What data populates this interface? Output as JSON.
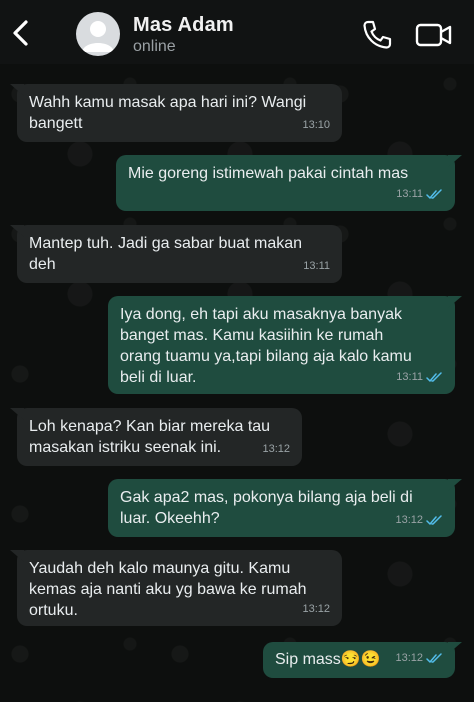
{
  "contact": {
    "name": "Mas Adam",
    "status": "online"
  },
  "colors": {
    "incoming": "#232626",
    "outgoing": "#1f4c3f",
    "tick": "#53bdeb"
  },
  "messages": [
    {
      "dir": "in",
      "text": "Wahh kamu masak apa hari ini? Wangi\nbangett",
      "time": "13:10"
    },
    {
      "dir": "out",
      "text": "Mie goreng istimewah pakai cintah mas",
      "time": "13:11"
    },
    {
      "dir": "in",
      "text": "Mantep tuh. Jadi ga sabar buat makan\ndeh",
      "time": "13:11"
    },
    {
      "dir": "out",
      "text": "Iya dong, eh tapi aku masaknya banyak\nbanget mas. Kamu kasiihin ke rumah\norang tuamu ya,tapi bilang aja kalo kamu\nbeli di luar.",
      "time": "13:11"
    },
    {
      "dir": "in",
      "text": "Loh kenapa? Kan biar mereka tau\nmasakan istriku seenak ini.",
      "time": "13:12"
    },
    {
      "dir": "out",
      "text": "Gak apa2 mas, pokonya bilang aja beli di\nluar. Okeehh?",
      "time": "13:12"
    },
    {
      "dir": "in",
      "text": "Yaudah deh kalo maunya gitu. Kamu\nkemas aja nanti aku yg bawa ke rumah\nortuku.",
      "time": "13:12"
    },
    {
      "dir": "out",
      "text": "Sip mass😏😉",
      "time": "13:12"
    }
  ]
}
